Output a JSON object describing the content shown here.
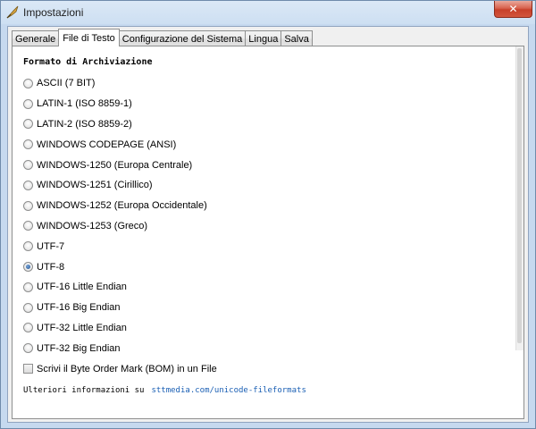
{
  "window": {
    "title": "Impostazioni",
    "close_glyph": "✕",
    "app_icon": "quill-icon"
  },
  "tabs": [
    {
      "label": "Generale",
      "active": false
    },
    {
      "label": "File di Testo",
      "active": true
    },
    {
      "label": "Configurazione del Sistema",
      "active": false
    },
    {
      "label": "Lingua",
      "active": false
    },
    {
      "label": "Salva",
      "active": false
    }
  ],
  "panel": {
    "section_title": "Formato di Archiviazione",
    "options": [
      {
        "label": "ASCII (7 BIT)",
        "checked": false
      },
      {
        "label": "LATIN-1 (ISO 8859-1)",
        "checked": false
      },
      {
        "label": "LATIN-2 (ISO 8859-2)",
        "checked": false
      },
      {
        "label": "WINDOWS CODEPAGE (ANSI)",
        "checked": false
      },
      {
        "label": "WINDOWS-1250 (Europa Centrale)",
        "checked": false
      },
      {
        "label": "WINDOWS-1251 (Cirillico)",
        "checked": false
      },
      {
        "label": "WINDOWS-1252 (Europa Occidentale)",
        "checked": false
      },
      {
        "label": "WINDOWS-1253 (Greco)",
        "checked": false
      },
      {
        "label": "UTF-7",
        "checked": false
      },
      {
        "label": "UTF-8",
        "checked": true
      },
      {
        "label": "UTF-16 Little Endian",
        "checked": false
      },
      {
        "label": "UTF-16 Big Endian",
        "checked": false
      },
      {
        "label": "UTF-32 Little Endian",
        "checked": false
      },
      {
        "label": "UTF-32 Big Endian",
        "checked": false
      }
    ],
    "bom_checkbox": {
      "label": "Scrivi il Byte Order Mark (BOM) in un File",
      "checked": false
    },
    "more_info": {
      "text": "Ulteriori informazioni su",
      "link": "sttmedia.com/unicode-fileformats"
    }
  },
  "colors": {
    "link": "#1a5fb4",
    "close_button": "#c7402a",
    "radio_selected": "#1f4f8f"
  }
}
